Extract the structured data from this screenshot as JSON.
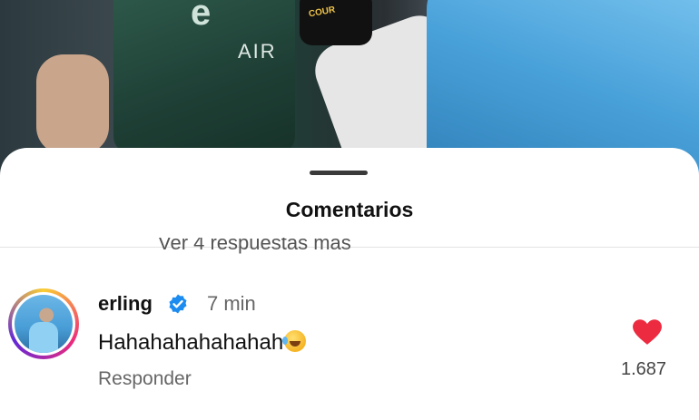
{
  "background": {
    "brand_text": "AIR",
    "glove_brand": "COUR"
  },
  "sheet": {
    "title": "Comentarios",
    "more_replies": "Ver 4 respuestas más"
  },
  "comment": {
    "username": "erling",
    "verified": true,
    "time": "7 min",
    "text": "Hahahahahahahah",
    "emoji": "face-with-tears-of-joy",
    "reply_label": "Responder",
    "likes": "1.687",
    "liked": true
  },
  "colors": {
    "heart": "#ed2b40",
    "verified_badge": "#1d8cf0",
    "sheet_bg": "#ffffff"
  }
}
